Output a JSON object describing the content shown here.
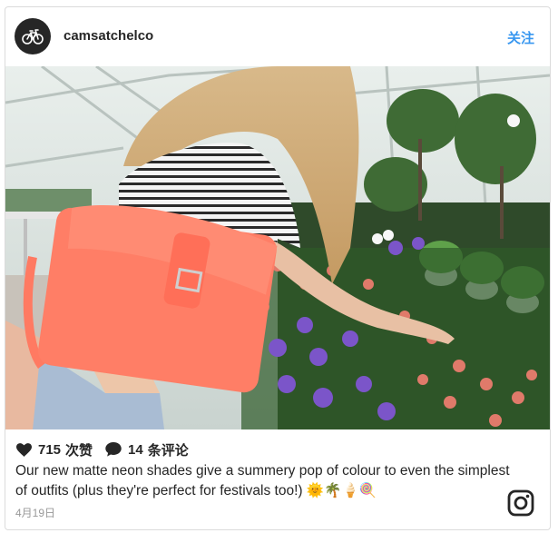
{
  "post": {
    "username": "camsatchelco",
    "follow_label": "关注",
    "likes_count": "715",
    "likes_label": "次赞",
    "comments_count": "14",
    "comments_label": "条评论",
    "caption": "Our new matte neon shades give a summery pop of colour to even the simplest of outfits (plus they're perfect for festivals too!) 🌞🌴🍦🍭",
    "date": "4月19日"
  },
  "icons": {
    "avatar": "bicycle-icon",
    "like": "heart-icon",
    "comment": "speech-bubble-icon",
    "brand": "instagram-icon"
  },
  "colors": {
    "accent": "#3897f0",
    "text": "#262626",
    "muted": "#999999",
    "border": "#dbdbdb"
  }
}
